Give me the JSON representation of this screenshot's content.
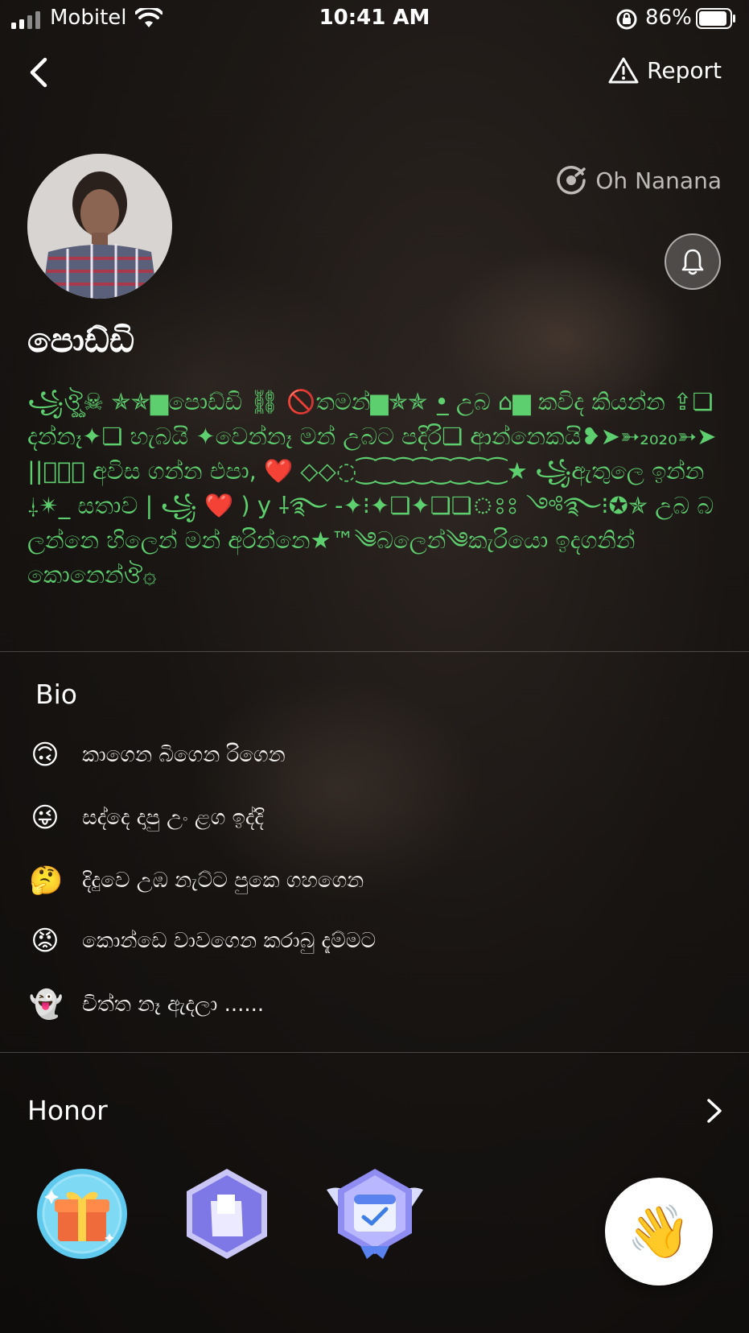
{
  "status_bar": {
    "carrier": "Mobitel",
    "time": "10:41 AM",
    "battery": "86%"
  },
  "nav": {
    "report_label": "Report"
  },
  "profile": {
    "music_title": "Oh Nanana",
    "username": "පොඩ්ඩි",
    "status": "꧁ঔৣ☠︎ ✯✯▆පොඩ්ඩි ⛓ 🚫තමන්▆✯✯ •̲ උබ ⌂▆ කවිද කියන්න ⇪❏ දන්නෑ✦❏ හැබයි ✦වෙන්නෑ මන් උබට පදිරි❏ ආන්නෙකයි❥➤➳₂₀₂₀➳➤||ঔৣ⃝ අවිස ගන්න එපා, ❤️ ◇◇◌⁐⁐⁐⁐⁐⁐⁐⁐★ ꧁ඇතුලෙ ඉන්න ⸸✴︎_ සතාව | ꧁ ❤️ ) y ⸸࿐ -✦⁝✦❏✦❏❏ঃঃ ༺࿐⁝✪✯ උබ බලන්නෙ හිලෙන් මන් අරින්නෙ★™༄බලෙන්༄කැරියො ඉදගනින් කොනෙන්ঔ۞"
  },
  "bio": {
    "title": "Bio",
    "items": [
      {
        "emoji": "🙃",
        "text": "කාගෙන බිගෙන රිගෙන"
      },
      {
        "emoji": "😜",
        "text": "සද්දෙ දාපු උං ළග ඉද්දි"
      },
      {
        "emoji": "🤔",
        "text": "දිදුවෙ උඹ නැට්ට පුකෙ ගහගෙන"
      },
      {
        "emoji": "😡",
        "text": "කොන්ඩෙ වාවගෙන කරාබු දැම්මට"
      },
      {
        "emoji": "👻",
        "text": "චිත්ත නෑ ඇදලා ......"
      }
    ]
  },
  "honor": {
    "title": "Honor",
    "badges": [
      "gift-badge-icon",
      "hexagon-profile-badge-icon",
      "winged-calendar-badge-icon"
    ]
  },
  "actions": {
    "wave": "👋"
  }
}
